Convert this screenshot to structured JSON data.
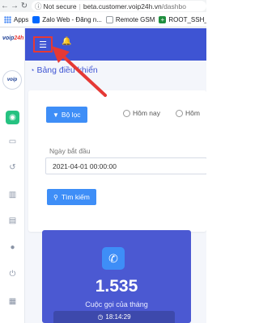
{
  "browser": {
    "security_label": "Not secure",
    "url_domain": "beta.customer.voip24h.vn",
    "url_path": "/dashbo",
    "bookmarks": [
      {
        "label": "Apps",
        "icon": "apps-grid-icon"
      },
      {
        "label": "Zalo Web - Đăng n...",
        "icon": "zalo-icon",
        "color": "#0068ff"
      },
      {
        "label": "Remote GSM",
        "icon": "page-icon",
        "color": "#9aa0a6"
      },
      {
        "label": "ROOT_SSH_",
        "icon": "plus-icon",
        "color": "#1e8e3e"
      }
    ]
  },
  "sidebar": {
    "logo_text": "voip",
    "logo_suffix": "24h",
    "avatar_text": "voip",
    "items": [
      {
        "name": "dashboard",
        "icon": "dashboard-icon",
        "active": true
      },
      {
        "name": "monitor",
        "icon": "monitor-icon",
        "active": false
      },
      {
        "name": "history",
        "icon": "history-icon",
        "active": false
      },
      {
        "name": "reports",
        "icon": "chart-icon",
        "active": false
      },
      {
        "name": "documents",
        "icon": "document-icon",
        "active": false
      },
      {
        "name": "user",
        "icon": "user-icon",
        "active": false
      },
      {
        "name": "power",
        "icon": "power-icon",
        "active": false
      },
      {
        "name": "contacts",
        "icon": "contacts-icon",
        "active": false
      }
    ]
  },
  "header": {
    "menu_icon": "hamburger-icon",
    "bell_icon": "bell-icon",
    "accent_color": "#3e54d3",
    "highlight_color": "#e53935"
  },
  "main": {
    "page_title": "Bảng điều khiển",
    "filter_button": "Bộ lọc",
    "radio_today": "Hôm nay",
    "radio_other": "Hôm",
    "start_date_label": "Ngày bắt đầu",
    "start_date_value": "2021-04-01 00:00:00",
    "search_button": "Tìm kiếm"
  },
  "stat": {
    "value": "1.535",
    "label": "Cuộc gọi của tháng",
    "time": "18:14:29",
    "card_color": "#4b59d2"
  }
}
